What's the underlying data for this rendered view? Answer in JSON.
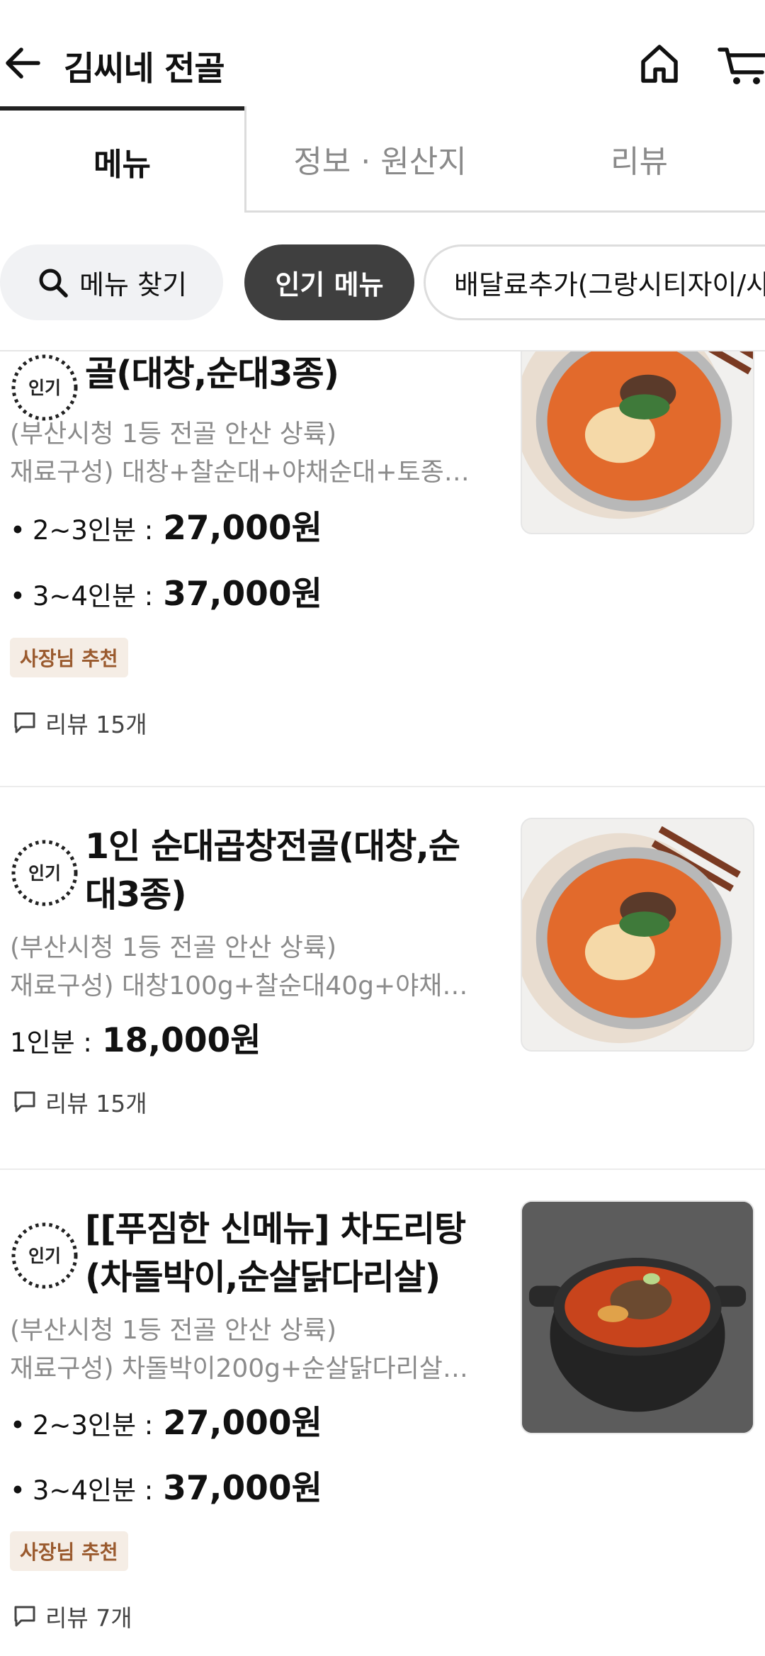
{
  "header": {
    "title": "김씨네 전골",
    "back_icon": "arrow-left-icon",
    "home_icon": "home-icon",
    "cart_icon": "cart-icon"
  },
  "tabs": [
    {
      "label": "메뉴",
      "active": true
    },
    {
      "label": "정보 · 원산지",
      "active": false
    },
    {
      "label": "리뷰",
      "active": false
    }
  ],
  "filters": {
    "search_label": "메뉴 찾기",
    "popular_label": "인기 메뉴",
    "delivery_label": "배달료추가(그랑시티자이/사"
  },
  "menu_items": [
    {
      "badge": "인기",
      "name": "골(대창,순대3종)",
      "desc_line1": "(부산시청 1등 전골 안산 상륙)",
      "desc_line2": "재료구성) 대창+찰순대+야채순대+토종…",
      "prices": [
        {
          "label": "2~3인분 :",
          "value": "27,000원"
        },
        {
          "label": "3~4인분 :",
          "value": "37,000원"
        }
      ],
      "owner_badge": "사장님 추천",
      "reviews": "리뷰 15개"
    },
    {
      "badge": "인기",
      "name_line1": "1인 순대곱창전골(대창,순",
      "name_line2": "대3종)",
      "desc_line1": "(부산시청 1등 전골 안산 상륙)",
      "desc_line2": "재료구성) 대창100g+찰순대40g+야채…",
      "prices": [
        {
          "label": "1인분 :",
          "value": "18,000원"
        }
      ],
      "reviews": "리뷰 15개"
    },
    {
      "badge": "인기",
      "name_line1": "[[푸짐한 신메뉴] 차도리탕",
      "name_line2": "(차돌박이,순살닭다리살)",
      "desc_line1": "(부산시청 1등 전골 안산 상륙)",
      "desc_line2": "재료구성) 차돌박이200g+순살닭다리살…",
      "prices": [
        {
          "label": "2~3인분 :",
          "value": "27,000원"
        },
        {
          "label": "3~4인분 :",
          "value": "37,000원"
        }
      ],
      "owner_badge": "사장님 추천",
      "reviews": "리뷰 7개"
    }
  ]
}
